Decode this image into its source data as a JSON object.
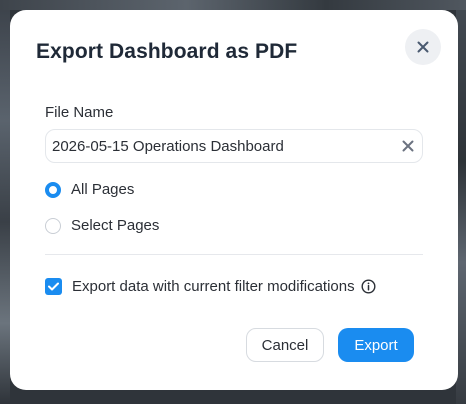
{
  "dialog": {
    "title": "Export Dashboard as PDF",
    "close_icon": "close-icon"
  },
  "file_name": {
    "label": "File Name",
    "value": "2026-05-15 Operations Dashboard",
    "clear_icon": "clear-icon"
  },
  "pages": {
    "options": [
      {
        "label": "All Pages",
        "selected": true
      },
      {
        "label": "Select Pages",
        "selected": false
      }
    ]
  },
  "filter_option": {
    "label": "Export data with current filter modifications",
    "checked": true,
    "info_icon": "info-icon"
  },
  "actions": {
    "cancel_label": "Cancel",
    "export_label": "Export"
  },
  "colors": {
    "accent": "#1a8cf0",
    "title": "#1f2937",
    "text": "#2b2f36"
  }
}
